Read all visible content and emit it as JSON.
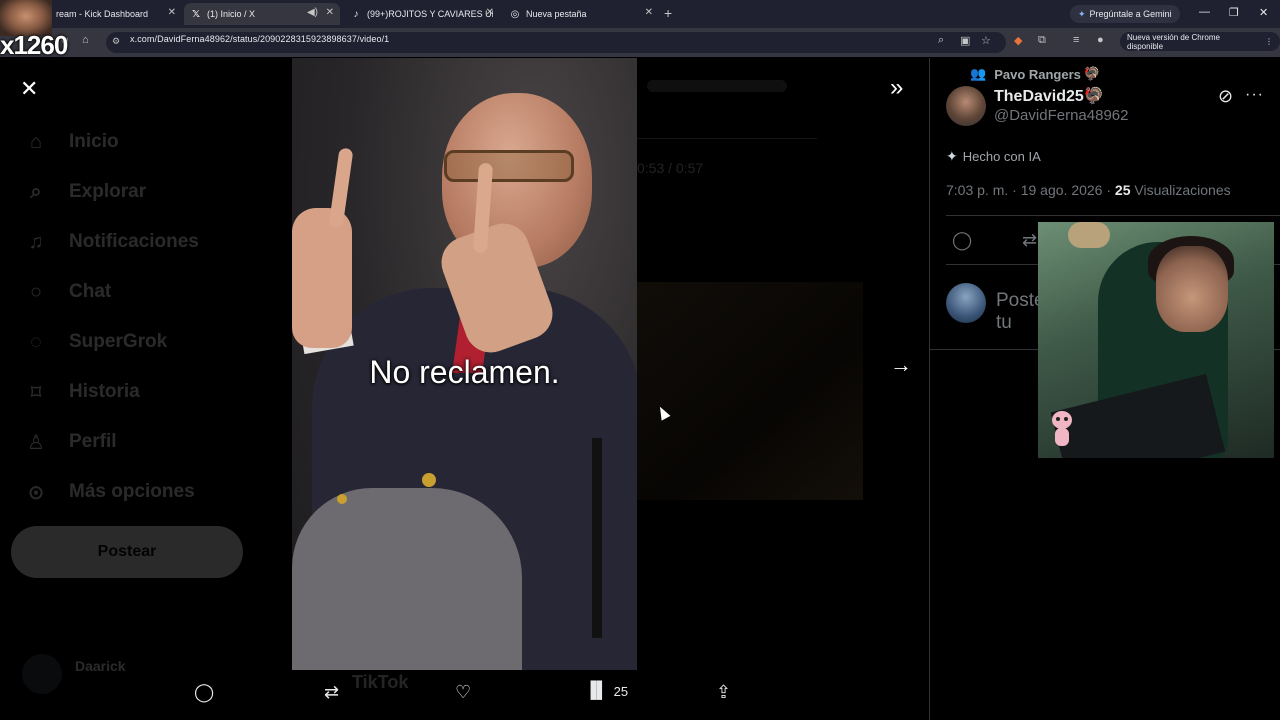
{
  "browser": {
    "tabs": [
      {
        "title": "ream - Kick Dashboard",
        "icon": "kick-icon",
        "active": false
      },
      {
        "title": "(1) Inicio / X",
        "icon": "x-logo-icon",
        "active": true
      },
      {
        "title": "(99+)ROJITOS Y CAVIARES UNI",
        "icon": "tiktok-icon",
        "active": false
      },
      {
        "title": "Nueva pestaña",
        "icon": "chrome-icon",
        "active": false
      }
    ],
    "gemini_label": "Pregúntale a Gemini",
    "url": "x.com/DavidFerna48962/status/2090228315923898637/video/1",
    "update_label": "Nueva versión de Chrome disponible"
  },
  "stream_overlay": {
    "tag": "x1260"
  },
  "sidebar": {
    "items": [
      {
        "label": "Inicio",
        "icon": "home-icon"
      },
      {
        "label": "Explorar",
        "icon": "search-icon"
      },
      {
        "label": "Notificaciones",
        "icon": "bell-icon"
      },
      {
        "label": "Chat",
        "icon": "chat-icon"
      },
      {
        "label": "SuperGrok",
        "icon": "grok-icon"
      },
      {
        "label": "Historia",
        "icon": "bookmark-icon"
      },
      {
        "label": "Perfil",
        "icon": "user-icon"
      },
      {
        "label": "Más opciones",
        "icon": "more-circle-icon"
      }
    ],
    "post_button": "Postear",
    "account_name": "Daarick"
  },
  "feed_background": {
    "time_text": "0:53 / 0:57",
    "tiktok_watermark": "TikTok"
  },
  "video": {
    "caption": "No reclamen."
  },
  "actions": {
    "views": "25"
  },
  "tweet": {
    "social_context": "Pavo Rangers",
    "display_name": "TheDavid25",
    "handle": "@DavidFerna48962",
    "made_with_ai": "Hecho con IA",
    "time": "7:03 p. m.",
    "date": "19 ago. 2026",
    "views": "25",
    "views_label": "Visualizaciones",
    "reply_placeholder": "Postea tu respuesta"
  }
}
